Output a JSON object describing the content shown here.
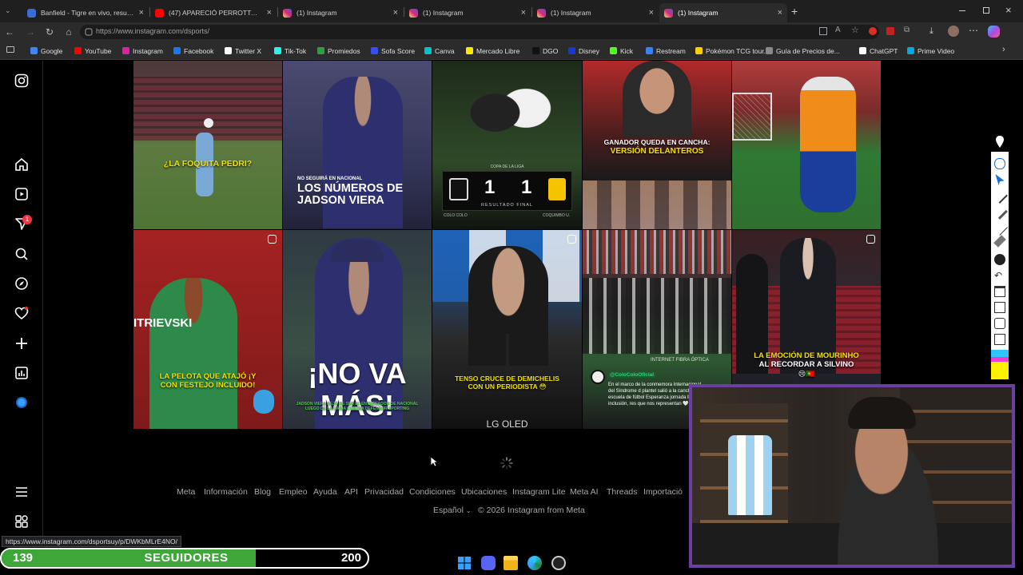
{
  "browser": {
    "tabs": [
      {
        "title": "Banfield - Tigre en vivo, resultado",
        "icon": "banfield-favicon",
        "color": "#3b6cd6",
        "active": false
      },
      {
        "title": "(47) APARECIÓ PERROTTA, EL TAL",
        "icon": "youtube-icon",
        "color": "#ff0000",
        "active": false
      },
      {
        "title": "(1) Instagram",
        "icon": "instagram-icon",
        "color": "#d6249f",
        "active": false
      },
      {
        "title": "(1) Instagram",
        "icon": "instagram-icon",
        "color": "#d6249f",
        "active": false
      },
      {
        "title": "(1) Instagram",
        "icon": "instagram-icon",
        "color": "#d6249f",
        "active": false
      },
      {
        "title": "(1) Instagram",
        "icon": "instagram-icon",
        "color": "#d6249f",
        "active": true
      }
    ],
    "new_tab_symbol": "+",
    "close_symbol": "×",
    "url": "https://www.instagram.com/dsports/",
    "bookmarks": [
      {
        "label": "Google",
        "color": "#4285f4"
      },
      {
        "label": "YouTube",
        "color": "#ff0000"
      },
      {
        "label": "Instagram",
        "color": "#d6249f"
      },
      {
        "label": "Facebook",
        "color": "#1877f2"
      },
      {
        "label": "Twitter X",
        "color": "#ffffff"
      },
      {
        "label": "Tik-Tok",
        "color": "#25f4ee"
      },
      {
        "label": "Promiedos",
        "color": "#2e9e44"
      },
      {
        "label": "Sofa Score",
        "color": "#374df5"
      },
      {
        "label": "Canva",
        "color": "#00c4cc"
      },
      {
        "label": "Mercado Libre",
        "color": "#ffe600"
      },
      {
        "label": "DGO",
        "color": "#111111"
      },
      {
        "label": "Disney",
        "color": "#113ccf"
      },
      {
        "label": "Kick",
        "color": "#53fc18"
      },
      {
        "label": "Restream",
        "color": "#3b82f6"
      },
      {
        "label": "Pokémon TCG tour...",
        "color": "#ffcb05"
      },
      {
        "label": "Guía de Precios de...",
        "color": "#8a8a8a"
      },
      {
        "label": "ChatGPT",
        "color": "#ffffff"
      },
      {
        "label": "Prime Video",
        "color": "#00a8e1"
      }
    ]
  },
  "sidebar": {
    "notification_count": "1",
    "items": [
      "instagram-logo",
      "home-icon",
      "reels-icon",
      "messages-icon",
      "search-icon",
      "explore-icon",
      "notifications-icon",
      "create-icon",
      "dashboard-icon",
      "profile-avatar",
      "more-menu-icon",
      "also-from-meta-icon"
    ]
  },
  "posts": [
    {
      "caption": "¿LA FOQUITA PEDRI?",
      "caption_color": "#f3e200",
      "bg": "#4f6f3a"
    },
    {
      "caption_small": "NO SEGUIRÁ EN NACIONAL",
      "caption": "LOS NÚMEROS DE JADSON VIERA",
      "caption_color": "#ffffff",
      "bg": "#3c3a55"
    },
    {
      "score_home": "1",
      "score_away": "1",
      "score_caption": "RESULTADO FINAL",
      "header": "COPA DE LA LIGA",
      "home_team": "COLO COLO",
      "away_team": "COQUIMBO U.",
      "bg": "#2c3a25"
    },
    {
      "caption": "GANADOR QUEDA EN CANCHA:",
      "caption2": "VERSIÓN DELANTEROS",
      "caption_color": "#ffffff",
      "caption2_color": "#f3e200",
      "bg": "#5a2a2a"
    },
    {
      "caption": "",
      "bg": "#7a2a2a"
    },
    {
      "caption": "LA PELOTA QUE ATAJÓ ¡Y CON FESTEJO INCLUIDO!",
      "caption_color": "#f3e200",
      "bg": "#8e2424"
    },
    {
      "caption": "¡NO VA MÁS!",
      "caption_small": "JADSON VIERA DEJÓ DE SER EL ENTRENADOR DE NACIONAL LUEGO DE LA CAÍDA CONTRA DEFENSOR SPORTING",
      "caption_color": "#ffffff",
      "bg": "#2e3340"
    },
    {
      "caption": "TENSO CRUCE DE DEMICHELIS CON UN PERIODISTA 😳",
      "caption_color": "#f3e200",
      "brand": "LG OLED",
      "bg": "#264a7a"
    },
    {
      "caption": "",
      "profile": "@ColoColoOficial",
      "desc": "En el marco de la conmemora Internacional del Síndrome d plantel salió a la cancha acom escuela de fútbol Esperanza jornada llena de inclusión, res que nos representan 🤍",
      "banner": "INTERNET FIBRA ÓPTICA",
      "bg": "#3a3a3a"
    },
    {
      "caption": "LA EMOCIÓN DE MOURINHO",
      "caption2": "AL RECORDAR A SILVINO",
      "emoji": "😢🇵🇹",
      "caption_color": "#f3e200",
      "caption2_color": "#ffffff",
      "bg": "#2a2a38"
    }
  ],
  "footer": {
    "links": [
      "Meta",
      "Información",
      "Blog",
      "Empleo",
      "Ayuda",
      "API",
      "Privacidad",
      "Condiciones",
      "Ubicaciones",
      "Instagram Lite",
      "Meta AI",
      "Threads",
      "Importació"
    ],
    "language": "Español",
    "copyright": "© 2026 Instagram from Meta"
  },
  "status_url": "https://www.instagram.com/dsportsuy/p/DWKbMLrE4NO/",
  "followers_goal": {
    "current": "139",
    "label": "SEGUIDORES",
    "target": "200",
    "progress": 0.695
  },
  "colors": {
    "accent": "#3fa63a",
    "webcam_border": "#6b3fa0",
    "ig_badge": "#ff3040"
  }
}
